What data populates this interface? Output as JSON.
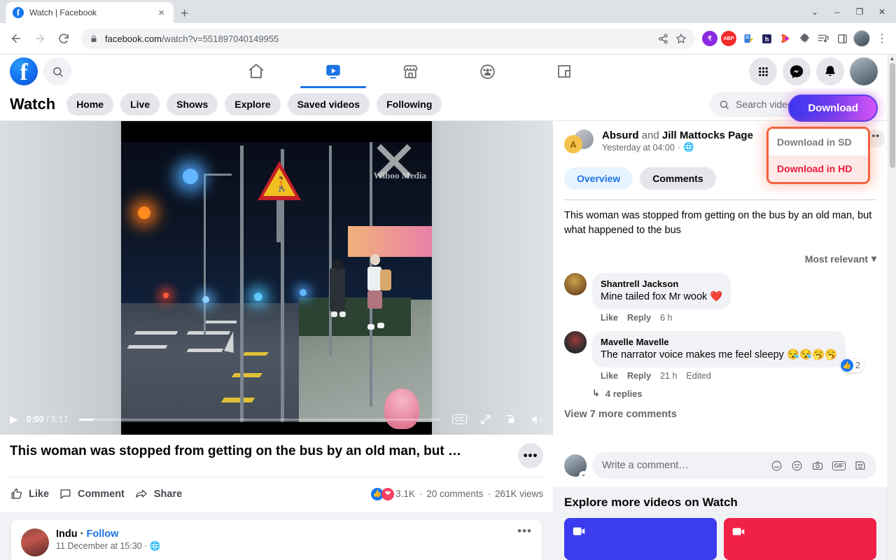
{
  "browser": {
    "tab": {
      "title": "Watch | Facebook",
      "favicon": "facebook-icon",
      "close": "×"
    },
    "new_tab": "+",
    "window_controls": {
      "minimize": "–",
      "maximize": "❐",
      "close": "✕",
      "tab_search": "⌄"
    },
    "nav": {
      "back": "←",
      "forward": "→",
      "reload": "⟳"
    },
    "omnibox": {
      "lock_icon": "lock-icon",
      "url_domain": "facebook.com",
      "url_path": "/watch?v=551897040149955",
      "share_icon": "share-icon",
      "bookmark_icon": "star-icon"
    },
    "extensions": [
      {
        "name": "rupee-extension",
        "label": "₹",
        "color": "#8a2be2",
        "shape": "circle"
      },
      {
        "name": "adblock-extension",
        "label": "ABP",
        "color": "#f22c2c",
        "shape": "circle"
      },
      {
        "name": "notes-extension",
        "label": "📝",
        "color": "#ffffff",
        "shape": "square"
      },
      {
        "name": "honey-extension",
        "label": "h",
        "color": "#1f1f5c",
        "shape": "square"
      },
      {
        "name": "video-downloader-extension",
        "label": "▶",
        "color": "#ffffff",
        "shape": "square"
      },
      {
        "name": "puzzle-extensions-icon",
        "label": "🧩",
        "color": "#5f6368",
        "shape": "square"
      },
      {
        "name": "reading-list-icon",
        "label": "≡♪",
        "color": "#5f6368",
        "shape": "square"
      },
      {
        "name": "side-panel-icon",
        "label": "▯",
        "color": "#5f6368",
        "shape": "square"
      }
    ],
    "profile": "profile-avatar",
    "menu": "⋮"
  },
  "facebook_nav": {
    "logo": "facebook-logo",
    "search_icon": "search-icon",
    "tabs": [
      {
        "name": "home",
        "icon": "home-icon",
        "active": false
      },
      {
        "name": "watch",
        "icon": "video-icon",
        "active": true
      },
      {
        "name": "marketplace",
        "icon": "store-icon",
        "active": false
      },
      {
        "name": "groups",
        "icon": "groups-icon",
        "active": false
      },
      {
        "name": "gaming",
        "icon": "gaming-icon",
        "active": false
      }
    ],
    "right": [
      {
        "name": "menu-grid",
        "icon": "grid-icon"
      },
      {
        "name": "messenger",
        "icon": "messenger-icon"
      },
      {
        "name": "notifications",
        "icon": "bell-icon"
      },
      {
        "name": "account",
        "icon": "avatar"
      }
    ]
  },
  "watch_header": {
    "title": "Watch",
    "pills": [
      "Home",
      "Live",
      "Shows",
      "Explore",
      "Saved videos",
      "Following"
    ],
    "search": {
      "placeholder": "Search videos",
      "icon": "search-icon"
    },
    "download_button": "Download"
  },
  "download_menu": {
    "sd": "Download in SD",
    "hd": "Download in HD",
    "dots": "••",
    "border_color": "#f4613e",
    "hd_color": "#ef1a3a",
    "hd_bg": "#fde9e7"
  },
  "video": {
    "play_icon": "play-icon",
    "current_time": "0:00",
    "separator": "/",
    "total_time": "5:17",
    "controls": {
      "captions": "CC",
      "fullscreen": "expand-icon",
      "miniplayer": "miniplayer-icon",
      "mute": "mute-icon"
    },
    "watermark": "Wiboo Media",
    "title": "This woman was stopped from getting on the bus by an old man, but …",
    "more_options": "•••",
    "actions": [
      {
        "name": "like",
        "label": "Like",
        "icon": "thumbs-up-icon"
      },
      {
        "name": "comment",
        "label": "Comment",
        "icon": "comment-icon"
      },
      {
        "name": "share",
        "label": "Share",
        "icon": "share-arrow-icon"
      }
    ],
    "stats": {
      "reactions": "3.1K",
      "comments": "20 comments",
      "views": "261K views",
      "dot": "·"
    }
  },
  "post_card": {
    "author": "Indu",
    "separator": "·",
    "follow": "Follow",
    "timestamp": "11 December at 15:30",
    "globe_icon": "globe-icon",
    "more": "•••"
  },
  "side_panel": {
    "poster": {
      "avatar_initial": "A",
      "name1": "Absurd",
      "and": "and",
      "name2": "Jill Mattocks Page",
      "timestamp": "Yesterday at 04:00",
      "dot": "·",
      "privacy_icon": "globe-icon"
    },
    "tabs": [
      {
        "label": "Overview",
        "selected": true
      },
      {
        "label": "Comments",
        "selected": false
      }
    ],
    "description": "This woman was stopped from getting on the bus by an old man, but what happened to the bus",
    "sort": {
      "label": "Most relevant",
      "caret": "▾"
    },
    "comments": [
      {
        "name": "Shantrell Jackson",
        "text": "Mine tailed fox Mr wook ❤️",
        "like": "Like",
        "reply": "Reply",
        "time": "6 h",
        "edited": "",
        "reaction_count": "",
        "replies": ""
      },
      {
        "name": "Mavelle Mavelle",
        "text": "The narrator voice makes me feel sleepy 😪😪🥱🥱",
        "like": "Like",
        "reply": "Reply",
        "time": "21 h",
        "edited": "Edited",
        "reaction_count": "2",
        "replies": "4 replies"
      }
    ],
    "view_more": "View 7 more comments",
    "composer": {
      "placeholder": "Write a comment…",
      "icons": [
        "sticker-icon",
        "emoji-icon",
        "camera-icon",
        "gif-icon",
        "avatar-sticker-icon"
      ]
    },
    "explore": {
      "heading": "Explore more videos on Watch",
      "cards": [
        {
          "name": "live-card",
          "color": "#3b3bf0",
          "icon": "video-icon"
        },
        {
          "name": "reels-card",
          "color": "#f02048",
          "icon": "camera-icon"
        }
      ]
    }
  }
}
